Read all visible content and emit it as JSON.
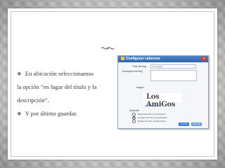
{
  "slide": {
    "bullets": [
      {
        "line1": "En ubicación seleccionamos",
        "line2": "la opción “en lugar del título y la",
        "line3": "descripción”."
      },
      {
        "line1": "Y por último guardar."
      }
    ]
  },
  "dialog": {
    "title": "Configurar cabecera",
    "close_icon": "×",
    "fields": {
      "blog_title_label": "Título del blog",
      "blog_title_value": "Los Amigos",
      "description_label": "Descripción del blog",
      "image_label": "Imagen",
      "remove_link": "Quitar imagen",
      "location_label": "Ubicación",
      "options": [
        "Detrás del título y la descripción",
        "En lugar del título y la descripción",
        "Debajo del título y la descripción"
      ],
      "selected_option_index": 1
    },
    "logo_text": "Los AmiGos",
    "buttons": {
      "save": "Guardar",
      "cancel": "Cancelar"
    }
  },
  "colors": {
    "titlebar": "#2f63a6",
    "link": "#2a5db0",
    "text": "#3b3b3b"
  },
  "icons": {
    "bullet": "diamond-bullet-icon",
    "ornament": "flourish-icon"
  }
}
